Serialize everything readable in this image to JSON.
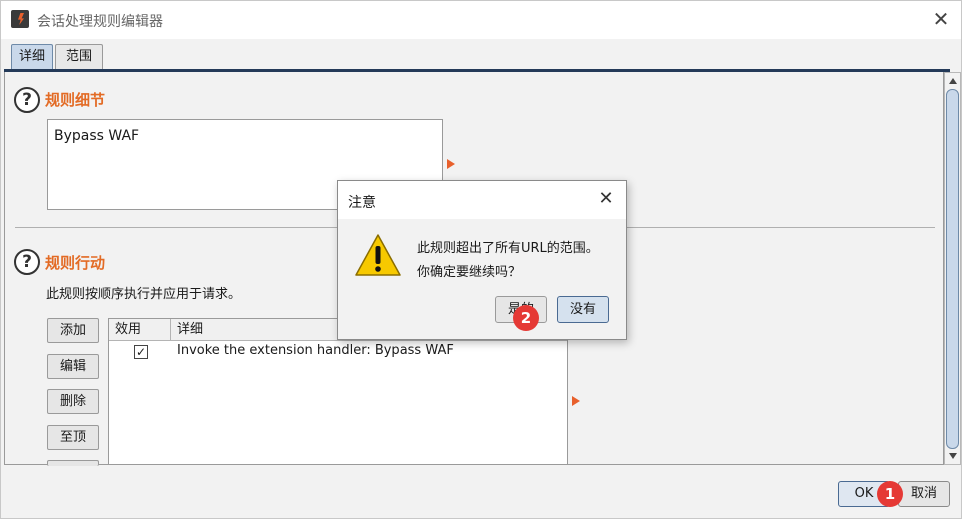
{
  "window": {
    "title": "会话处理规则编辑器",
    "close_symbol": "✕"
  },
  "tabs": [
    {
      "label": "详细"
    },
    {
      "label": "范围"
    }
  ],
  "rule_details": {
    "help_symbol": "?",
    "title": "规则细节",
    "description_value": "Bypass WAF"
  },
  "rule_actions": {
    "help_symbol": "?",
    "title": "规则行动",
    "description": "此规则按顺序执行并应用于请求。",
    "buttons": {
      "add": "添加",
      "edit": "编辑",
      "remove": "删除",
      "top": "至顶"
    },
    "table": {
      "columns": {
        "enabled": "效用",
        "details": "详细"
      },
      "rows": [
        {
          "enabled": true,
          "check": "✓",
          "details": "Invoke the extension handler: Bypass WAF"
        }
      ]
    }
  },
  "footer": {
    "ok": "OK",
    "cancel": "取消"
  },
  "badges": {
    "first": "1",
    "second": "2"
  },
  "dialog": {
    "title": "注意",
    "close_symbol": "✕",
    "message_line1": "此规则超出了所有URL的范围。",
    "message_line2": "你确定要继续吗？",
    "yes": "是的",
    "no": "没有"
  },
  "colors": {
    "accent": "#e36b25",
    "badge": "#e53935",
    "selected": "#c9d8ea"
  }
}
